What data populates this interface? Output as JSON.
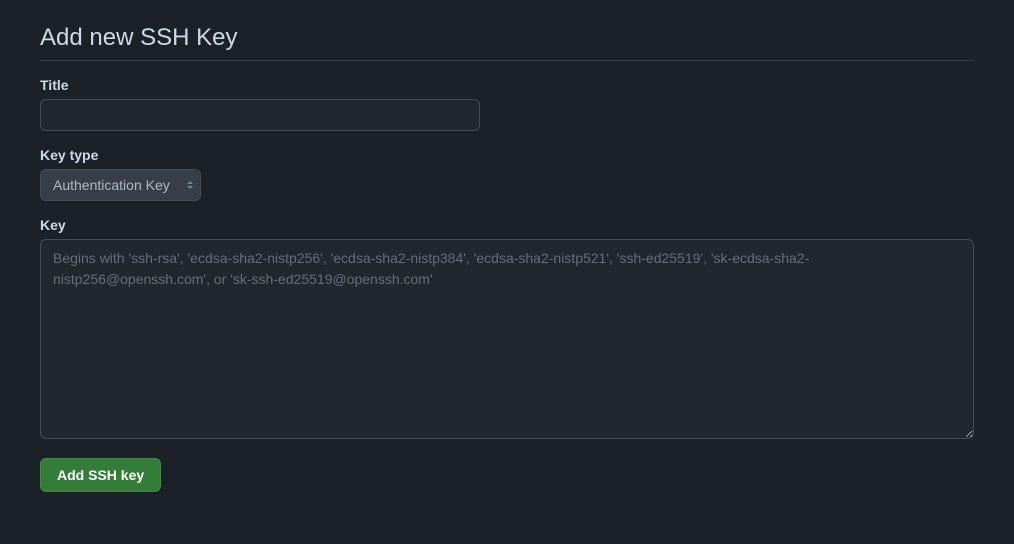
{
  "page": {
    "title": "Add new SSH Key"
  },
  "form": {
    "title": {
      "label": "Title",
      "value": ""
    },
    "keyType": {
      "label": "Key type",
      "selected": "Authentication Key"
    },
    "key": {
      "label": "Key",
      "value": "",
      "placeholder": "Begins with 'ssh-rsa', 'ecdsa-sha2-nistp256', 'ecdsa-sha2-nistp384', 'ecdsa-sha2-nistp521', 'ssh-ed25519', 'sk-ecdsa-sha2-nistp256@openssh.com', or 'sk-ssh-ed25519@openssh.com'"
    },
    "submit": {
      "label": "Add SSH key"
    }
  }
}
